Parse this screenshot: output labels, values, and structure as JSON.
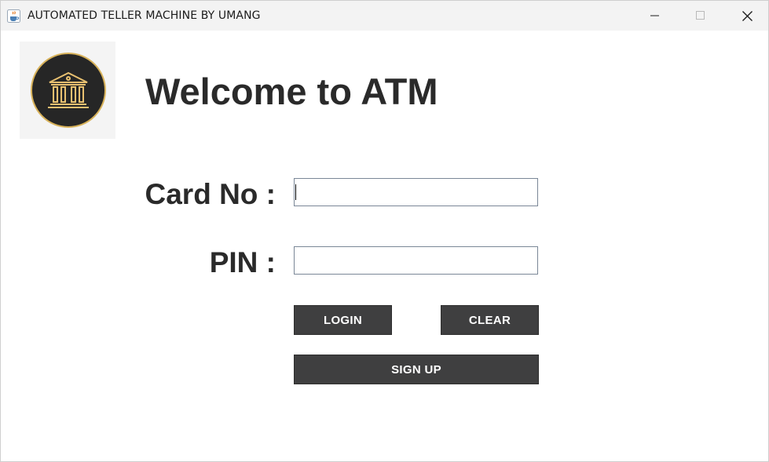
{
  "window": {
    "title": "AUTOMATED TELLER MACHINE BY UMANG",
    "icon": "java-cup-icon",
    "controls": [
      "minimize-icon",
      "maximize-icon",
      "close-icon"
    ]
  },
  "header": {
    "logo_icon": "bank-building-icon",
    "title": "Welcome to ATM"
  },
  "form": {
    "card_label": "Card No :",
    "card_value": "",
    "pin_label": "PIN :",
    "pin_value": ""
  },
  "buttons": {
    "login": "LOGIN",
    "clear": "CLEAR",
    "signup": "SIGN UP"
  },
  "colors": {
    "button_bg": "#3f3f40",
    "logo_ring": "#d8b25a",
    "logo_bg": "#262626"
  }
}
